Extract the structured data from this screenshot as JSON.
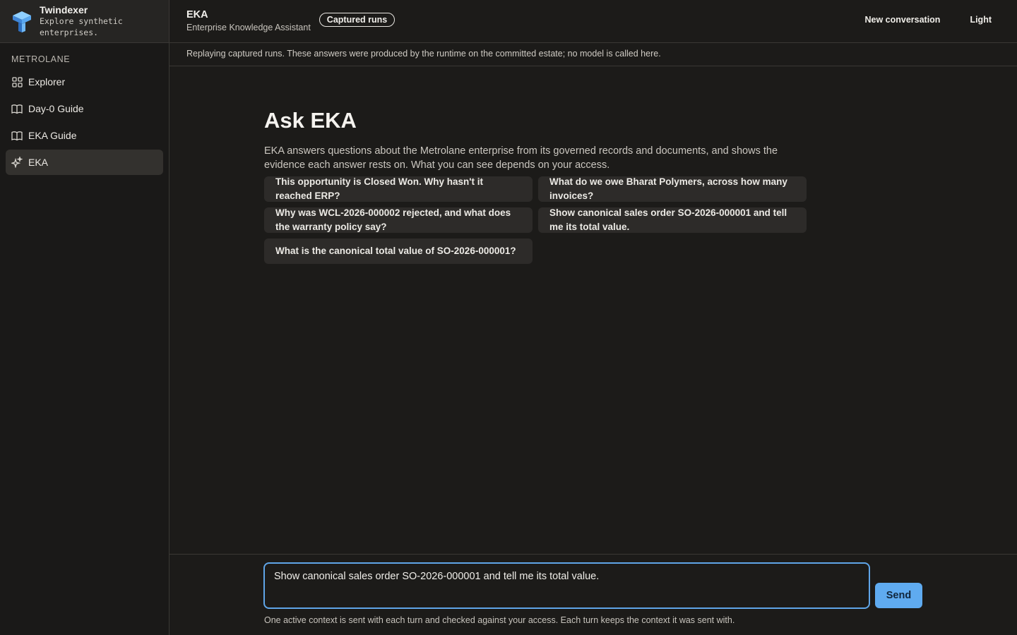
{
  "brand": {
    "title": "Twindexer",
    "subtitle": "Explore synthetic enterprises."
  },
  "sidebar": {
    "section": "METROLANE",
    "items": [
      {
        "label": "Explorer",
        "icon": "grid-icon",
        "active": false
      },
      {
        "label": "Day-0 Guide",
        "icon": "book-icon",
        "active": false
      },
      {
        "label": "EKA Guide",
        "icon": "book-icon",
        "active": false
      },
      {
        "label": "EKA",
        "icon": "sparkle-icon",
        "active": true
      }
    ]
  },
  "header": {
    "title": "EKA",
    "subtitle": "Enterprise Knowledge Assistant",
    "badge": "Captured runs",
    "actions": {
      "new_conversation": "New conversation",
      "theme": "Light"
    }
  },
  "notice": "Replaying captured runs. These answers were produced by the runtime on the committed estate; no model is called here.",
  "main": {
    "heading": "Ask EKA",
    "intro": "EKA answers questions about the Metrolane enterprise from its governed records and documents, and shows the evidence each answer rests on. What you can see depends on your access.",
    "suggestions": [
      "This opportunity is Closed Won. Why hasn't it reached ERP?",
      "What do we owe Bharat Polymers, across how many invoices?",
      "Why was WCL-2026-000002 rejected, and what does the warranty policy say?",
      "Show canonical sales order SO-2026-000001 and tell me its total value.",
      "What is the canonical total value of SO-2026-000001?"
    ]
  },
  "composer": {
    "value": "Show canonical sales order SO-2026-000001 and tell me its total value.",
    "send_label": "Send",
    "hint": "One active context is sent with each turn and checked against your access. Each turn keeps the context it was sent with."
  },
  "colors": {
    "accent": "#5fabf0",
    "focus_border": "#5fa5e8",
    "background": "#1c1b19"
  }
}
